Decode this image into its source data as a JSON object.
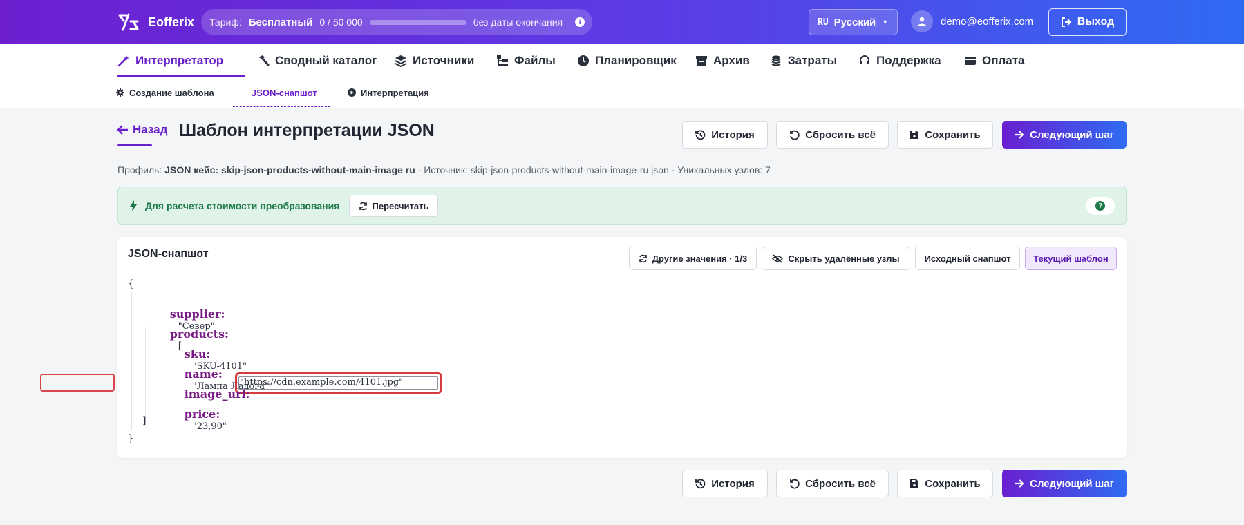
{
  "header": {
    "brand": "Eofferix",
    "tariff": {
      "label": "Тариф:",
      "plan": "Бесплатный",
      "usage": "0 / 50 000",
      "usage_fraction": 0,
      "expiry": "без даты окончания"
    },
    "language": {
      "code": "RU",
      "label": "Русский"
    },
    "user_email": "demo@eofferix.com",
    "logout_label": "Выход"
  },
  "nav": {
    "items": [
      {
        "label": "Интерпретатор",
        "icon": "wand-icon",
        "active": true
      },
      {
        "label": "Сводный каталог",
        "icon": "hammer-icon"
      },
      {
        "label": "Источники",
        "icon": "layers-icon"
      },
      {
        "label": "Файлы",
        "icon": "folder-tree-icon"
      },
      {
        "label": "Планировщик",
        "icon": "clock-icon"
      },
      {
        "label": "Архив",
        "icon": "archive-icon"
      },
      {
        "label": "Затраты",
        "icon": "coins-icon"
      },
      {
        "label": "Поддержка",
        "icon": "headset-icon"
      },
      {
        "label": "Оплата",
        "icon": "credit-card-icon"
      }
    ]
  },
  "subnav": {
    "items": [
      {
        "label": "Создание шаблона",
        "icon": "gear-icon"
      },
      {
        "label": "JSON-снапшот",
        "active": true
      },
      {
        "label": "Интерпретация",
        "icon": "play-circle-icon"
      }
    ]
  },
  "page": {
    "back_label": "Назад",
    "title": "Шаблон интерпретации JSON",
    "actions": {
      "history": "История",
      "reset": "Сбросить всё",
      "save": "Сохранить",
      "next": "Следующий шаг"
    },
    "meta": {
      "profile_label": "Профиль:",
      "profile_value": "JSON кейс: skip-json-products-without-main-image ru",
      "source": "· Источник: skip-json-products-without-main-image-ru.json · Уникальных узлов: 7"
    }
  },
  "banner": {
    "text": "Для расчета стоимости преобразования",
    "recalc_label": "Пересчитать",
    "help": "?"
  },
  "snapshot": {
    "title": "JSON-снапшот",
    "toolbar": {
      "other_values": "Другие значения · 1/3",
      "hide_deleted": "Скрыть удалённые узлы",
      "source_snapshot": "Исходный снапшот",
      "current_template": "Текущий шаблон"
    },
    "json": {
      "open_brace": "{",
      "close_brace": "}",
      "supplier_key": "supplier:",
      "supplier_value": "\"Север\"",
      "products_key": "products:",
      "open_bracket": "[",
      "close_bracket": "]",
      "sku_key": "sku:",
      "sku_value": "\"SKU-4101\"",
      "name_key": "name:",
      "name_value": "\"Лампа Ладога\"",
      "image_key": "image_url:",
      "image_value": "\"https://cdn.example.com/4101.jpg\"",
      "price_key": "price:",
      "price_value": "\"23,90\""
    }
  },
  "colors": {
    "brand_purple": "#6a1fcc",
    "brand_blue": "#2f6bf2",
    "success_green": "#1e7a4b",
    "highlight_red": "#d53a3e",
    "json_key": "#7a1c86"
  }
}
